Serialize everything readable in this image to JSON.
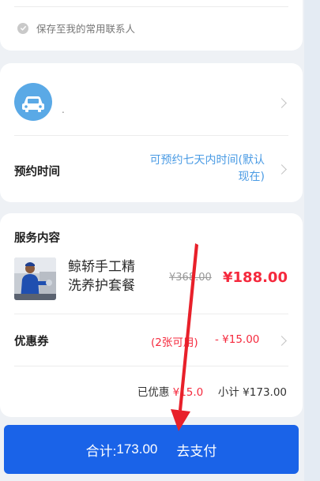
{
  "contact": {
    "save_label": "保存至我的常用联系人"
  },
  "vehicle": {
    "icon": "car-icon",
    "placeholder_text": "."
  },
  "appointment": {
    "label": "预约时间",
    "value_line1": "可预约七天内时间(默认",
    "value_line2": "现在)"
  },
  "service": {
    "section_title": "服务内容",
    "name_line1": "鲸轿手工精",
    "name_line2": "洗养护套餐",
    "original_price": "¥368.00",
    "price": "¥188.00"
  },
  "coupon": {
    "label": "优惠券",
    "count": "(2张可用)",
    "amount": "- ¥15.00"
  },
  "summary": {
    "discount_label": "已优惠",
    "discount_value": "¥15.0",
    "subtotal_label": "小计",
    "subtotal_value": "¥173.00"
  },
  "pay": {
    "total_label": "合计:",
    "total_value": "173.00",
    "action_label": "去支付"
  },
  "colors": {
    "accent_blue": "#1a63e8",
    "link_blue": "#4a9be4",
    "price_red": "#f5293d",
    "annotation_arrow": "#e8202a"
  }
}
